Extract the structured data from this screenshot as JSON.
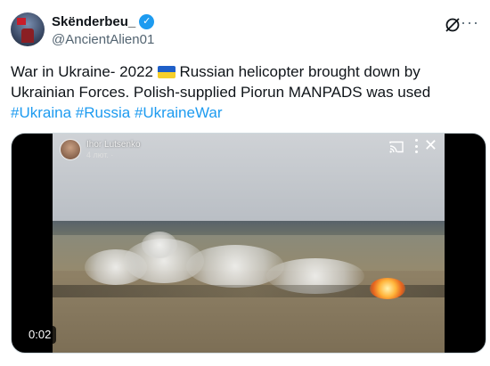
{
  "author": {
    "display_name": "Skënderbeu_",
    "handle": "@AncientAlien01",
    "verified_icon": "verified-badge-icon"
  },
  "tweet": {
    "text_1": "War in Ukraine- 2022 ",
    "flag_icon": "ukraine-flag-icon",
    "text_2": " Russian helicopter brought down by Ukrainian Forces. Polish-supplied Piorun MANPADS was used ",
    "hashtags": [
      "#Ukraina",
      "#Russia",
      "#UkraineWar"
    ]
  },
  "video": {
    "channel_name": "Ihor Lutsenko",
    "channel_sub": "4 лют. · ",
    "duration": "0:02"
  },
  "colors": {
    "link": "#1d9bf0",
    "text": "#0f1419",
    "secondary": "#536471"
  }
}
